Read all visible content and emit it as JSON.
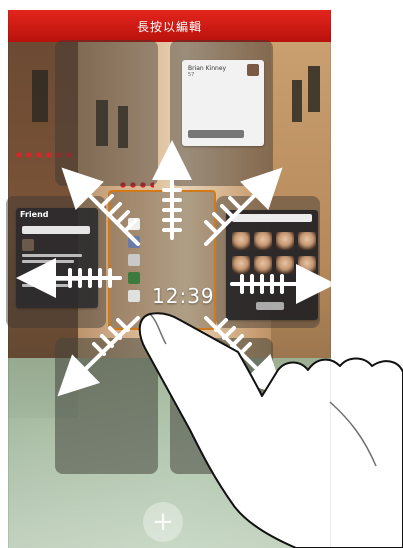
{
  "header": {
    "title": "長按以編輯"
  },
  "widgets": {
    "people": {
      "name": "Brian Kinney",
      "sub": "57"
    },
    "friend": {
      "title": "Friend"
    },
    "clock": {
      "time": "12:39"
    }
  },
  "colors": {
    "top_bar": "#c8170f",
    "selection_border": "#d27a1a",
    "arrow_fill": "#ffffff"
  },
  "icons": {
    "add": "plus-icon",
    "hint": "finger-gesture-icon",
    "arrows": "drag-arrows-icon"
  }
}
